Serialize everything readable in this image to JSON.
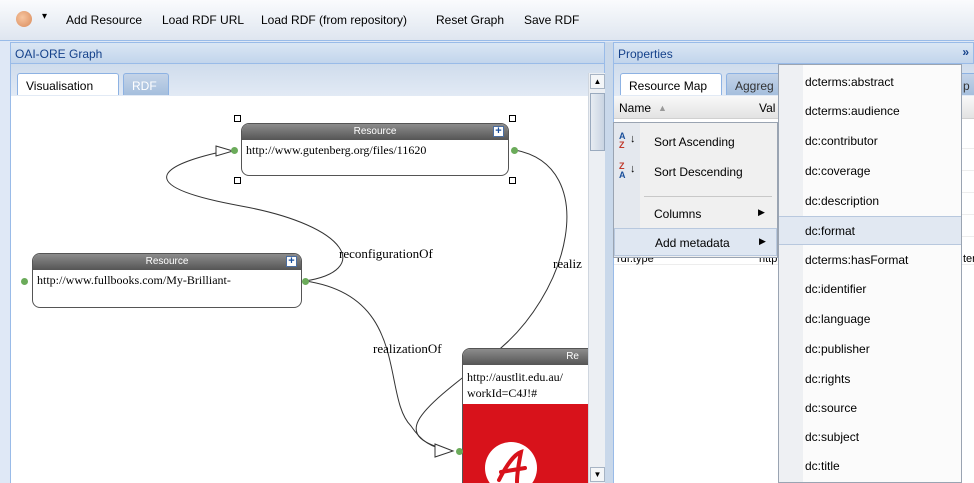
{
  "toolbar": {
    "items": [
      "Add Resource",
      "Load RDF URL",
      "Load RDF (from repository)",
      "Reset Graph",
      "Save RDF"
    ],
    "caret": "▾"
  },
  "left_panel": {
    "title": "OAI-ORE Graph",
    "tabs": [
      "Visualisation",
      "RDF"
    ],
    "nodes": [
      {
        "header": "Resource",
        "url": "http://www.gutenberg.org/files/11620"
      },
      {
        "header": "Resource",
        "url": "http://www.fullbooks.com/My-Brilliant-"
      },
      {
        "header": "Re",
        "url_line1": "http://austlit.edu.au/",
        "url_line2": "workId=C4J!#"
      }
    ],
    "edges": [
      "reconfigurationOf",
      "realizationOf",
      "realiz"
    ],
    "plus_glyph": "+"
  },
  "right_panel": {
    "title": "Properties",
    "collapse_glyph": "»",
    "tabs": [
      "Resource Map",
      "Aggreg",
      "p"
    ],
    "grid": {
      "col_name": "Name",
      "sort_glyph": "▲",
      "col_value": "Val",
      "row_partial": "rdf:type",
      "row_partial_value": "http",
      "row_partial_tail": "ter"
    },
    "context_menu": {
      "items": [
        {
          "label": "Sort Ascending",
          "icon_top": "A",
          "icon_bottom": "Z"
        },
        {
          "label": "Sort Descending",
          "icon_top": "Z",
          "icon_bottom": "A"
        },
        {
          "label": "Columns",
          "arrow": "▶"
        },
        {
          "label": "Add metadata",
          "arrow": "▶"
        }
      ]
    },
    "submenu": {
      "items": [
        "dcterms:abstract",
        "dcterms:audience",
        "dc:contributor",
        "dc:coverage",
        "dc:description",
        "dc:format",
        "dcterms:hasFormat",
        "dc:identifier",
        "dc:language",
        "dc:publisher",
        "dc:rights",
        "dc:source",
        "dc:subject",
        "dc:title"
      ],
      "highlighted": "dc:format"
    }
  },
  "colors": {
    "accent": "#99bbe8",
    "header_text": "#15428b",
    "node_header": "#6d6d6d",
    "logo_red": "#d8121b",
    "port_green": "#6bab5a"
  }
}
